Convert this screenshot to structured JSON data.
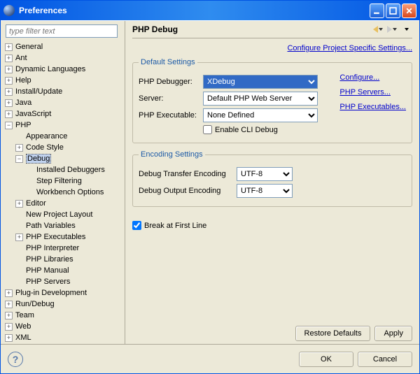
{
  "window": {
    "title": "Preferences"
  },
  "filter_placeholder": "type filter text",
  "tree": {
    "general": "General",
    "ant": "Ant",
    "dyn": "Dynamic Languages",
    "help": "Help",
    "install": "Install/Update",
    "java": "Java",
    "javascript": "JavaScript",
    "php": "PHP",
    "appearance": "Appearance",
    "codestyle": "Code Style",
    "debug": "Debug",
    "inst_debuggers": "Installed Debuggers",
    "step_filter": "Step Filtering",
    "workbench_opt": "Workbench Options",
    "editor": "Editor",
    "new_proj": "New Project Layout",
    "path_vars": "Path Variables",
    "php_exec": "PHP Executables",
    "php_interp": "PHP Interpreter",
    "php_libs": "PHP Libraries",
    "php_manual": "PHP Manual",
    "php_servers": "PHP Servers",
    "plugindev": "Plug-in Development",
    "rundebug": "Run/Debug",
    "team": "Team",
    "web": "Web",
    "xml": "XML"
  },
  "page": {
    "title": "PHP Debug",
    "project_link": "Configure Project Specific Settings..."
  },
  "defaults": {
    "legend": "Default Settings",
    "debugger_label": "PHP Debugger:",
    "debugger_value": "XDebug",
    "server_label": "Server:",
    "server_value": "Default PHP Web Server",
    "exec_label": "PHP Executable:",
    "exec_value": "None Defined",
    "cli_label": "Enable CLI Debug",
    "configure_link": "Configure...",
    "servers_link": "PHP Servers...",
    "execs_link": "PHP Executables..."
  },
  "encoding": {
    "legend": "Encoding Settings",
    "transfer_label": "Debug Transfer Encoding",
    "transfer_value": "UTF-8",
    "output_label": "Debug Output Encoding",
    "output_value": "UTF-8"
  },
  "break_first": "Break at First Line",
  "buttons": {
    "restore": "Restore Defaults",
    "apply": "Apply",
    "ok": "OK",
    "cancel": "Cancel"
  }
}
